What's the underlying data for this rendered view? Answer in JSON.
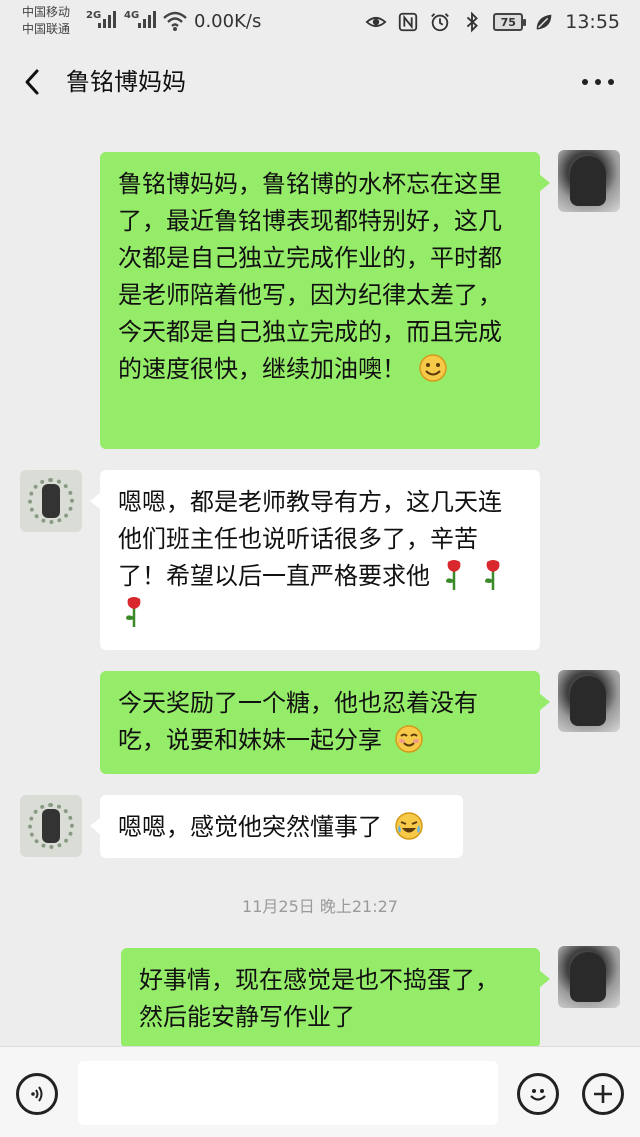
{
  "status_bar": {
    "carrier_1": "中国移动",
    "carrier_2": "中国联通",
    "net_1": "2G",
    "net_2": "4G",
    "net_speed": "0.00K/s",
    "battery": "75",
    "time": "13:55",
    "icons": [
      "signal-icon",
      "wifi-icon",
      "eye-icon",
      "nfc-icon",
      "alarm-icon",
      "bluetooth-icon",
      "battery-icon",
      "leaf-icon"
    ]
  },
  "header": {
    "title": "鲁铭博妈妈"
  },
  "messages": [
    {
      "side": "me",
      "text": "鲁铭博妈妈，鲁铭博的水杯忘在这里了，最近鲁铭博表现都特别好，这几次都是自己独立完成作业的，平时都是老师陪着他写，因为纪律太差了，今天都是自己独立完成的，而且完成的速度很快，继续加油噢！",
      "emoji": "smile-emoji"
    },
    {
      "side": "other",
      "text": "嗯嗯，都是老师教导有方，这几天连他们班主任也说听话很多了，辛苦了！希望以后一直严格要求他",
      "emoji": "rose-emoji"
    },
    {
      "side": "me",
      "text": "今天奖励了一个糖，他也忍着没有吃，说要和妹妹一起分享",
      "emoji": "shy-smile-emoji"
    },
    {
      "side": "other",
      "text": "嗯嗯，感觉他突然懂事了",
      "emoji": "tearful-laugh-emoji"
    },
    {
      "side": "me",
      "text": "好事情，现在感觉是也不捣蛋了，然后能安静写作业了",
      "emoji": ""
    }
  ],
  "timestamp": "11月25日 晚上21:27",
  "input_bar": {
    "value": ""
  },
  "colors": {
    "background": "#ededed",
    "my_bubble": "#95ec69",
    "their_bubble": "#ffffff"
  }
}
